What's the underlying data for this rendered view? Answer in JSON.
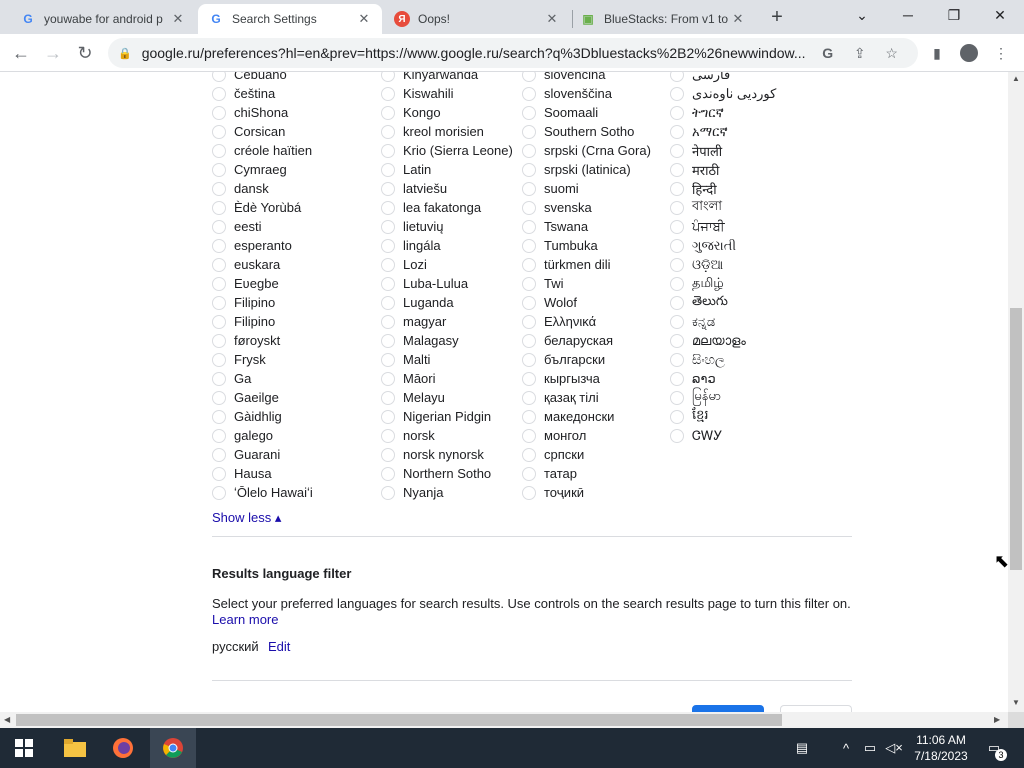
{
  "tabs": [
    {
      "title": "youwabe for android p",
      "close": "✕",
      "favicon": "G"
    },
    {
      "title": "Search Settings",
      "close": "✕",
      "favicon": "G"
    },
    {
      "title": "Oops!",
      "close": "✕",
      "favicon": "Я"
    },
    {
      "title": "BlueStacks: From v1 to",
      "close": "✕",
      "favicon": "▣"
    }
  ],
  "toolbar": {
    "url": "google.ru/preferences?hl=en&prev=https://www.google.ru/search?q%3Dbluestacks%2B2%26newwindow..."
  },
  "languages": {
    "col1": [
      "Cebuano",
      "čeština",
      "chiShona",
      "Corsican",
      "créole haïtien",
      "Cymraeg",
      "dansk",
      "Èdè Yorùbá",
      "eesti",
      "esperanto",
      "euskara",
      "Eʋegbe",
      "Filipino",
      "Filipino",
      "føroyskt",
      "Frysk",
      "Ga",
      "Gaeilge",
      "Gàidhlig",
      "galego",
      "Guarani",
      "Hausa",
      "ʻŌlelo Hawaiʻi"
    ],
    "col2": [
      "Kinyarwanda",
      "Kiswahili",
      "Kongo",
      "kreol morisien",
      "Krio (Sierra Leone)",
      "Latin",
      "latviešu",
      "lea fakatonga",
      "lietuvių",
      "lingála",
      "Lozi",
      "Luba-Lulua",
      "Luganda",
      "magyar",
      "Malagasy",
      "Malti",
      "Māori",
      "Melayu",
      "Nigerian Pidgin",
      "norsk",
      "norsk nynorsk",
      "Northern Sotho",
      "Nyanja"
    ],
    "col3": [
      "slovenčina",
      "slovenščina",
      "Soomaali",
      "Southern Sotho",
      "srpski (Crna Gora)",
      "srpski (latinica)",
      "suomi",
      "svenska",
      "Tswana",
      "Tumbuka",
      "türkmen dili",
      "Twi",
      "Wolof",
      "Ελληνικά",
      "беларуская",
      "български",
      "кыргызча",
      "қазақ тілі",
      "македонски",
      "монгол",
      "српски",
      "татар",
      "тоҷикӣ"
    ],
    "col4": [
      "فارسی",
      "کوردیی ناوەندی",
      "ትግርኛ",
      "አማርኛ",
      "नेपाली",
      "मराठी",
      "हिन्दी",
      "বাংলা",
      "ਪੰਜਾਬੀ",
      "ગુજરાતી",
      "ଓଡ଼ିଆ",
      "தமிழ்",
      "తెలుగు",
      "ಕನ್ನಡ",
      "മലയാളം",
      "සිංහල",
      "ລາວ",
      "မြန်မာ",
      "ខ្មែរ",
      "ᏣᎳᎩ"
    ]
  },
  "show_less": "Show less ▴",
  "results_filter": {
    "heading": "Results language filter",
    "description": "Select your preferred languages for search results. Use controls on the search results page to turn this filter on.",
    "learn_more": "Learn more",
    "selected_language": "русский",
    "edit": "Edit"
  },
  "taskbar": {
    "time": "11:06 AM",
    "date": "7/18/2023",
    "notification_count": "3"
  }
}
